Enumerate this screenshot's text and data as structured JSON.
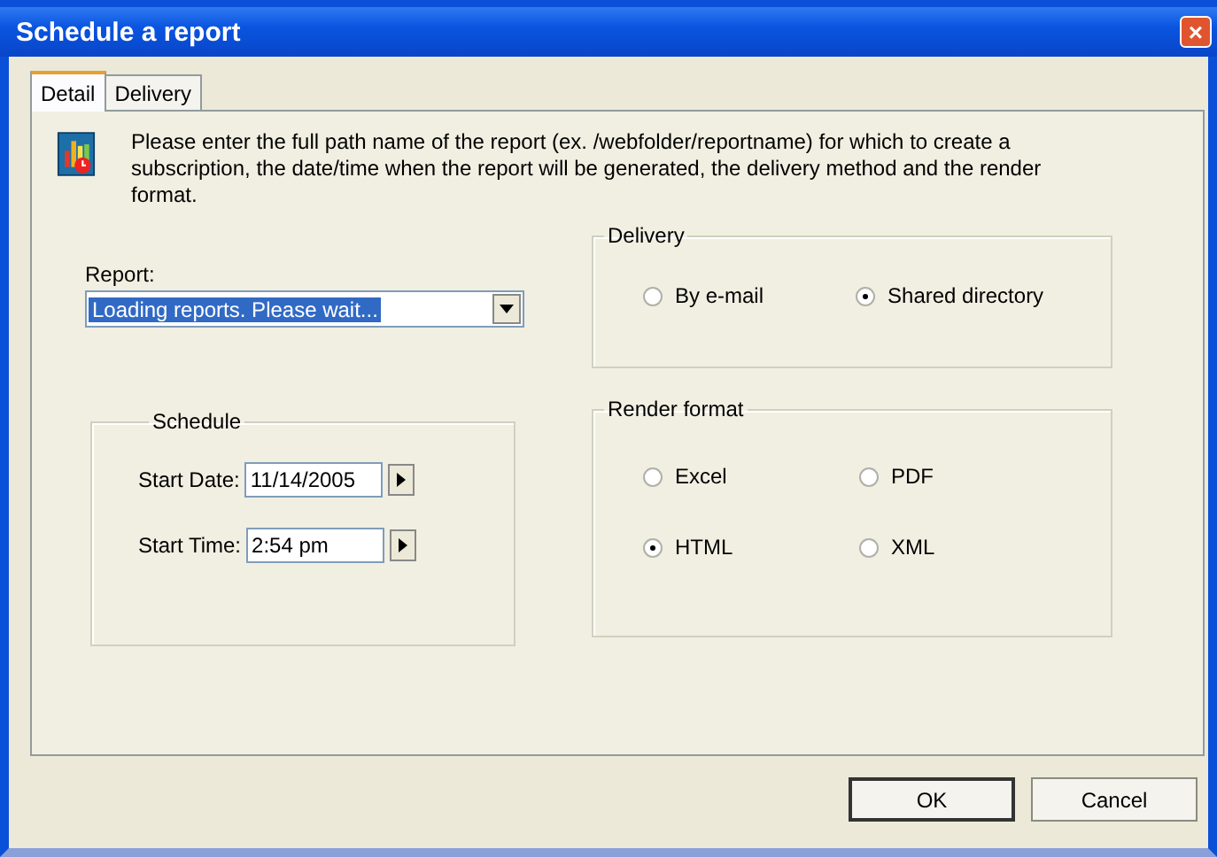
{
  "window": {
    "title": "Schedule a report",
    "close": "×"
  },
  "tabs": [
    {
      "label": "Detail",
      "selected": true
    },
    {
      "label": "Delivery",
      "selected": false
    }
  ],
  "intro": "Please enter the full path name of the report (ex. /webfolder/reportname) for which to create a subscription, the date/time when the report will be generated, the delivery method and the render format.",
  "report": {
    "label": "Report:",
    "value": "Loading reports. Please wait..."
  },
  "schedule": {
    "title": "Schedule",
    "fields": [
      {
        "label": "Start Date:",
        "value": "11/14/2005"
      },
      {
        "label": "Start Time:",
        "value": "2:54 pm"
      }
    ]
  },
  "delivery": {
    "title": "Delivery",
    "options": [
      {
        "label": "By e-mail",
        "selected": false
      },
      {
        "label": "Shared directory",
        "selected": true
      }
    ]
  },
  "render_format": {
    "title": "Render format",
    "options": [
      {
        "label": "Excel",
        "selected": false
      },
      {
        "label": "PDF",
        "selected": false
      },
      {
        "label": "HTML",
        "selected": true
      },
      {
        "label": "XML",
        "selected": false
      }
    ]
  },
  "buttons": [
    {
      "label": "OK",
      "default": true
    },
    {
      "label": "Cancel",
      "default": false
    }
  ]
}
